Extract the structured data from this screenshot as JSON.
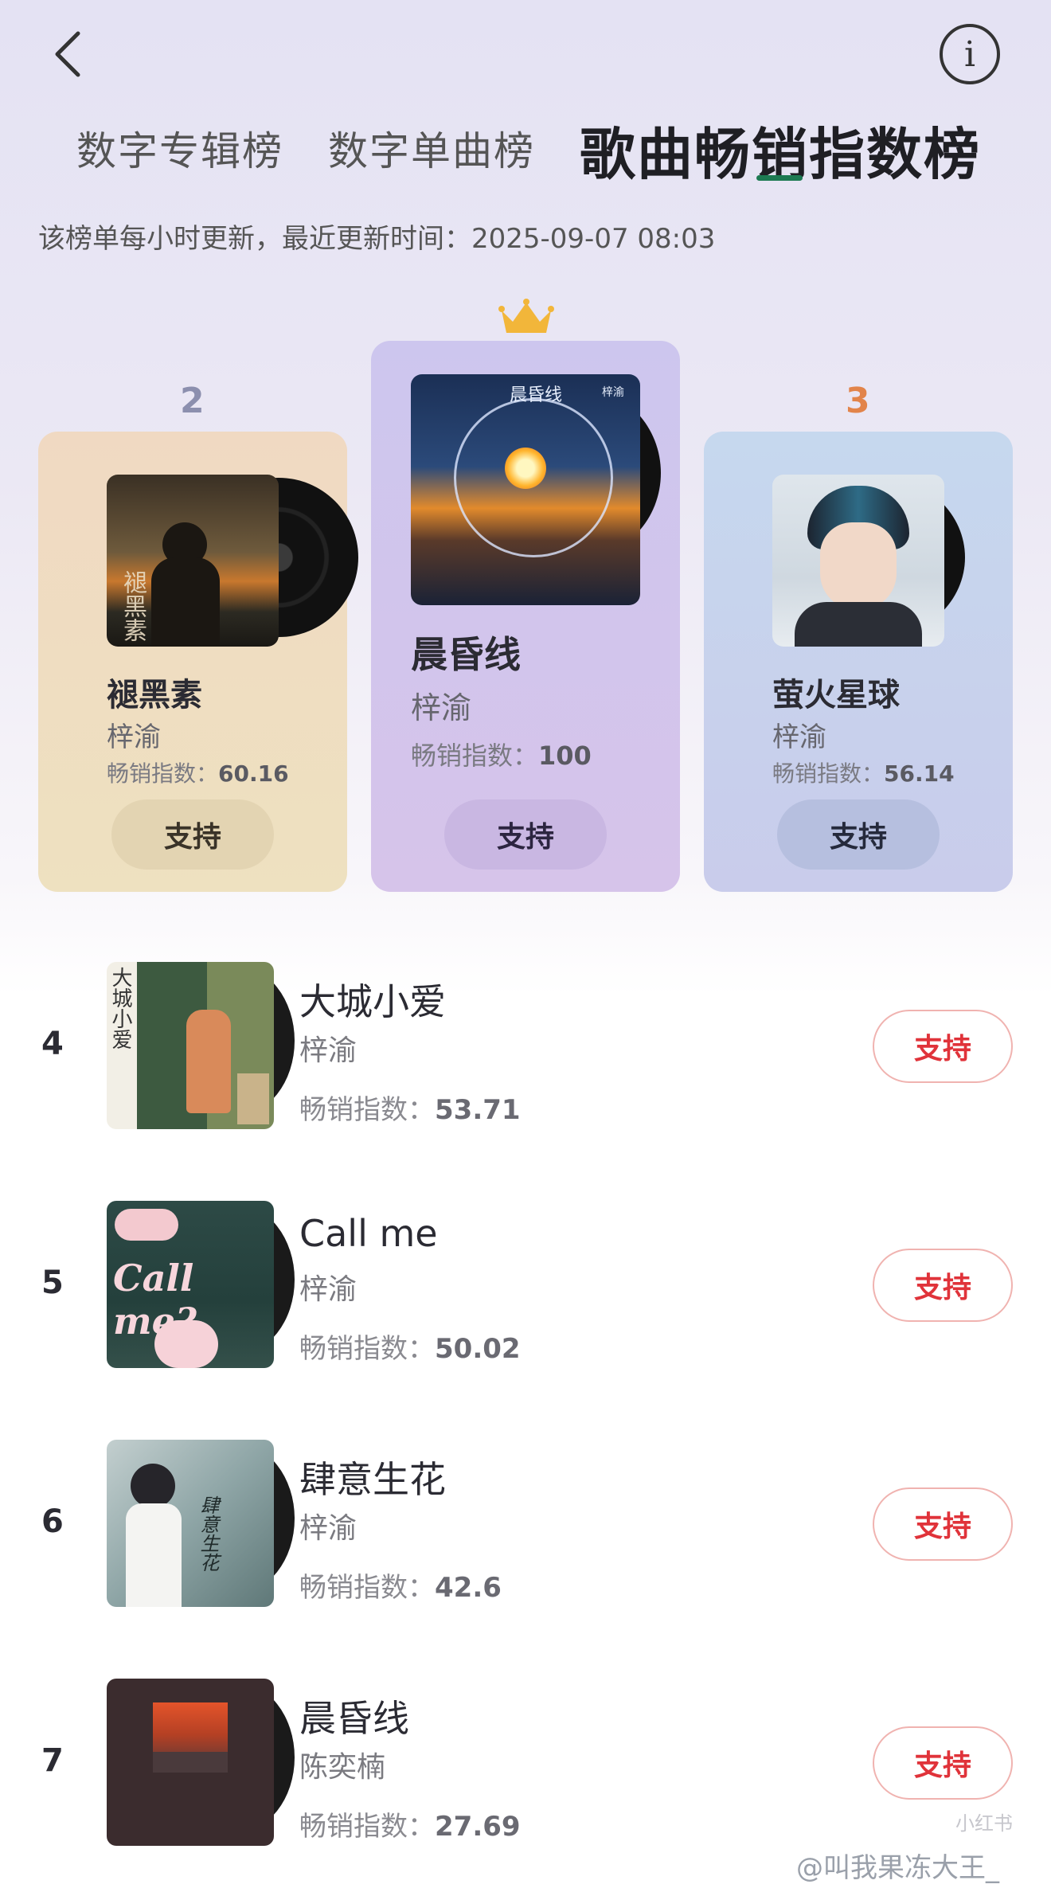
{
  "header": {
    "tabs": [
      "数字专辑榜",
      "数字单曲榜",
      "歌曲畅销指数榜"
    ],
    "update_note": "该榜单每小时更新，最近更新时间：2025-09-07 08:03"
  },
  "podium": [
    {
      "rank": "2",
      "title": "褪黑素",
      "artist": "梓渝",
      "index_label": "畅销指数：",
      "index_value": "60.16",
      "button": "支持",
      "cover_text": "褪黑素"
    },
    {
      "rank": "1",
      "title": "晨昏线",
      "artist": "梓渝",
      "index_label": "畅销指数：",
      "index_value": "100",
      "button": "支持",
      "cover_text": "晨昏线",
      "cover_small": "梓渝"
    },
    {
      "rank": "3",
      "title": "萤火星球",
      "artist": "梓渝",
      "index_label": "畅销指数：",
      "index_value": "56.14",
      "button": "支持"
    }
  ],
  "list": [
    {
      "rank": "4",
      "title": "大城小爱",
      "artist": "梓渝",
      "index_label": "畅销指数：",
      "index_value": "53.71",
      "button": "支持",
      "cover_text": "大城小爱"
    },
    {
      "rank": "5",
      "title": "Call me",
      "artist": "梓渝",
      "index_label": "畅销指数：",
      "index_value": "50.02",
      "button": "支持",
      "cover_text": "Call me?"
    },
    {
      "rank": "6",
      "title": "肆意生花",
      "artist": "梓渝",
      "index_label": "畅销指数：",
      "index_value": "42.6",
      "button": "支持",
      "cover_text": "肆意生花"
    },
    {
      "rank": "7",
      "title": "晨昏线",
      "artist": "陈奕楠",
      "index_label": "畅销指数：",
      "index_value": "27.69",
      "button": "支持"
    }
  ],
  "watermark": "@叫我果冻大王_",
  "watermark_logo": "小红书",
  "icons": {
    "back": "back-chevron-icon",
    "info": "info-icon",
    "crown": "crown-icon"
  },
  "colors": {
    "accent_red": "#e0333a",
    "tab_underline": "#1d7a52",
    "rank3_orange": "#e2844a"
  }
}
